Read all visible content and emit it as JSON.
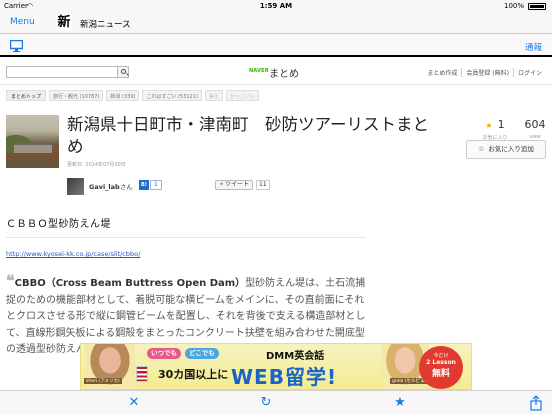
{
  "status_bar": {
    "carrier": "Carrier",
    "time": "1:59 AM",
    "battery": "100%"
  },
  "app_nav": {
    "menu_label": "Menu",
    "logo_glyph": "新",
    "title": "新潟ニュース"
  },
  "toolbar": {
    "notify_label": "通報"
  },
  "site_header": {
    "search_placeholder": "",
    "naver_label": "NAVER",
    "matome_label": "まとめ",
    "links": [
      "まとめ作成",
      "会員登録 (無料)",
      "ログイン"
    ]
  },
  "breadcrumbs": {
    "home": "まとめトップ",
    "tags": [
      "旅行・観光 (10787)",
      "新潟 (339)",
      "これはすごい (53121)",
      "美え",
      "かっこいい"
    ]
  },
  "article": {
    "title": "新潟県十日町市・津南町　砂防ツアーリストまとめ",
    "updated": "更新日: 2014年07月30日",
    "favorites_count": "1",
    "favorites_label": "お気に入り",
    "views_count": "604",
    "views_label": "view",
    "fav_add_label": "お気に入り追加",
    "author_name": "Gavi_lab",
    "author_suffix": "さん",
    "hatena_label": "B!",
    "hatena_count": "1",
    "tweet_label": "ツイート",
    "tweet_count": "11"
  },
  "content": {
    "heading": "ＣＢＢＯ型砂防えん堤",
    "link": "http://www.kyosei-kk.co.jp/case/slit/cbbo/",
    "quote_mark": "❝",
    "quote_bold": "CBBO（Cross Beam Buttress Open Dam）",
    "quote_text": "型砂防えん堤は、土石流捕捉のための機能部材として、着脱可能な横ビームをメインに、その直前面にそれとクロスさせる形で縦に鋼管ビームを配置し、それを背後で支える構造部材として、直線形鋼矢板による鋼殻をまとったコンクリート扶壁を組み合わせた開底型の透過型砂防えん堤です。"
  },
  "ad": {
    "tag1": "いつでも",
    "tag2": "どこでも",
    "brand": "DMM英会話",
    "name1": "sheri (アメリカ)",
    "name2": "grola (セルビア)",
    "countries": "30カ国以上に",
    "headline": "WEB留学!",
    "badge_line1": "今だけ",
    "badge_line2": "2 Lesson",
    "badge_line3": "無料"
  },
  "bottom_bar": {
    "close_icon": "close-icon",
    "reload_icon": "reload-icon",
    "star_icon": "star-icon",
    "share_icon": "share-icon"
  },
  "colors": {
    "ios_blue": "#1a7ae8",
    "naver_green": "#2db400",
    "star_gold": "#f0b400"
  }
}
